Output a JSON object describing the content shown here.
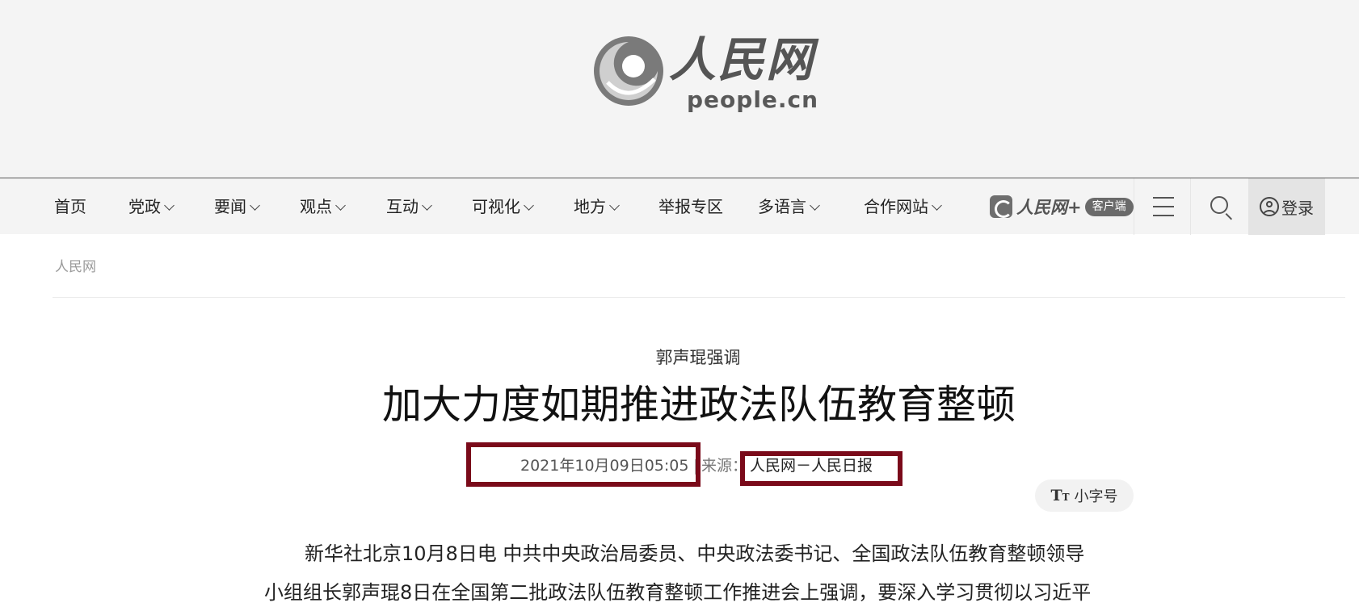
{
  "header": {
    "logo_cn": "人民网",
    "logo_en": "people.cn"
  },
  "nav": {
    "items": [
      {
        "label": "首页",
        "has_dropdown": false
      },
      {
        "label": "党政",
        "has_dropdown": true
      },
      {
        "label": "要闻",
        "has_dropdown": true
      },
      {
        "label": "观点",
        "has_dropdown": true
      },
      {
        "label": "互动",
        "has_dropdown": true
      },
      {
        "label": "可视化",
        "has_dropdown": true
      },
      {
        "label": "地方",
        "has_dropdown": true
      },
      {
        "label": "举报专区",
        "has_dropdown": false
      },
      {
        "label": "多语言",
        "has_dropdown": true
      },
      {
        "label": "合作网站",
        "has_dropdown": true
      }
    ],
    "app_name": "人民网+",
    "app_badge": "客户端",
    "menu_icon": "hamburger-icon",
    "search_icon": "search-icon",
    "login_label": "登录"
  },
  "breadcrumb": {
    "label": "人民网"
  },
  "article": {
    "kicker": "郭声琨强调",
    "title": "加大力度如期推进政法队伍教育整顿",
    "date": "2021年10月09日05:05",
    "separator": "|",
    "source_label": "来源：",
    "source": "人民网－人民日报",
    "font_toggle_label": "小字号",
    "paragraph_lines": [
      "新华社北京10月8日电  中共中央政治局委员、中央政法委书记、全国政法队伍教育整顿领导",
      "小组组长郭声琨8日在全国第二批政法队伍教育整顿工作推进会上强调，要深入学习贯彻以习近平"
    ]
  },
  "colors": {
    "highlight_box": "#7a0a1a",
    "header_bg": "#f4f4f4"
  }
}
